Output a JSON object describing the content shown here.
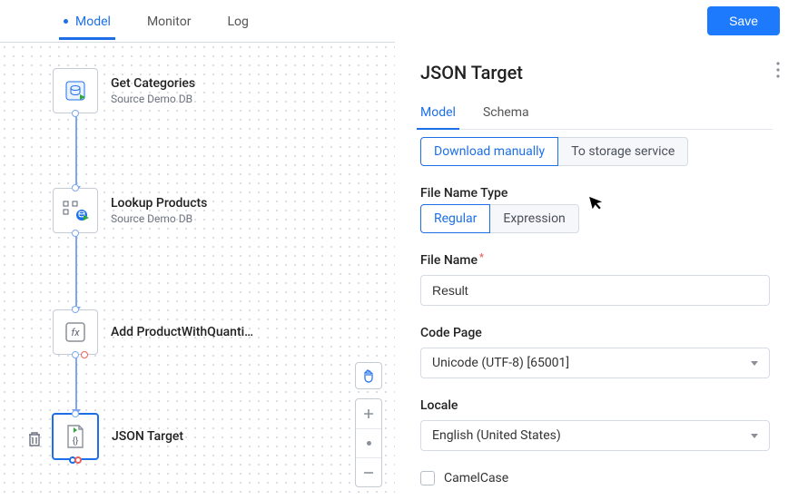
{
  "topbar": {
    "tabs": [
      "Model",
      "Monitor",
      "Log"
    ],
    "active_tab": "Model",
    "save_label": "Save"
  },
  "canvas": {
    "nodes": [
      {
        "id": "get-categories",
        "title": "Get Categories",
        "subtitle": "Source Demo DB",
        "icon": "db-source"
      },
      {
        "id": "lookup-products",
        "title": "Lookup Products",
        "subtitle": "Source Demo DB",
        "icon": "lookup"
      },
      {
        "id": "add-product",
        "title": "Add ProductWithQuanti…",
        "subtitle": "",
        "icon": "fx"
      },
      {
        "id": "json-target",
        "title": "JSON Target",
        "subtitle": "",
        "icon": "json-file",
        "selected": true
      }
    ],
    "controls": {
      "hand": "pan-tool",
      "zoom_in": "+",
      "zoom_reset": "•",
      "zoom_out": "−"
    }
  },
  "panel": {
    "title": "JSON Target",
    "tabs": [
      "Model",
      "Schema"
    ],
    "active_tab": "Model",
    "download_mode": {
      "options": [
        "Download manually",
        "To storage service"
      ],
      "selected": "Download manually"
    },
    "file_name_type": {
      "label": "File Name Type",
      "options": [
        "Regular",
        "Expression"
      ],
      "selected": "Regular"
    },
    "file_name": {
      "label": "File Name",
      "required": true,
      "value": "Result"
    },
    "code_page": {
      "label": "Code Page",
      "value": "Unicode (UTF-8) [65001]"
    },
    "locale": {
      "label": "Locale",
      "value": "English (United States)"
    },
    "camelcase": {
      "label": "CamelCase",
      "checked": false
    }
  }
}
